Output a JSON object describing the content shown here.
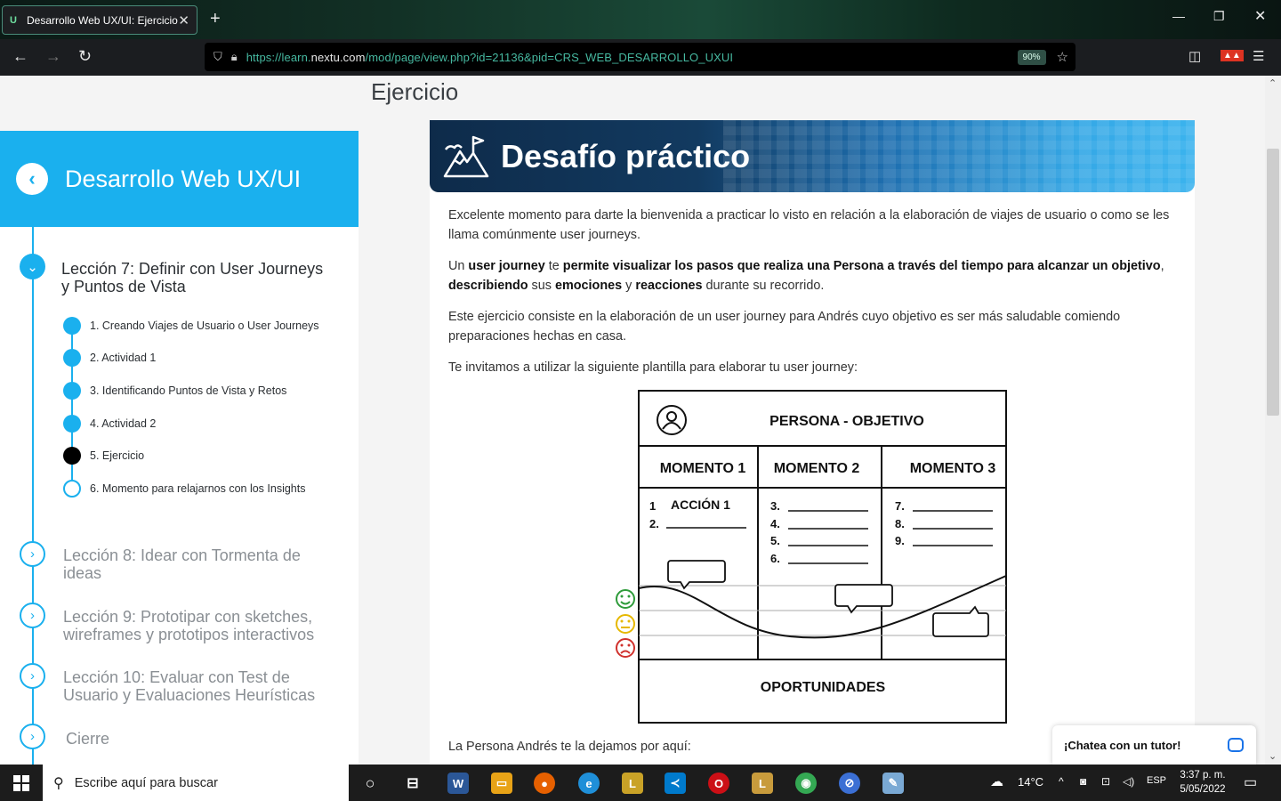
{
  "browser": {
    "tab_title": "Desarrollo Web UX/UI: Ejercicio",
    "tab_favicon": "U",
    "url_prefix": "https://learn.",
    "url_domain": "nextu.com",
    "url_path": "/mod/page/view.php?id=21136&pid=CRS_WEB_DESARROLLO_UXUI",
    "zoom": "90%"
  },
  "page": {
    "title": "Ejercicio"
  },
  "sidebar": {
    "course_title": "Desarrollo Web UX/UI",
    "active_lesson": "Lección 7: Definir con User Journeys y Puntos de Vista",
    "subitems": [
      {
        "label": "1. Creando Viajes de Usuario o User Journeys",
        "state": "done"
      },
      {
        "label": "2. Actividad 1",
        "state": "done"
      },
      {
        "label": "3. Identificando Puntos de Vista y Retos",
        "state": "done"
      },
      {
        "label": "4. Actividad 2",
        "state": "done"
      },
      {
        "label": "5. Ejercicio",
        "state": "current"
      },
      {
        "label": "6. Momento para relajarnos con los Insights",
        "state": "pending"
      }
    ],
    "lessons": [
      {
        "label": "Lección 8: Idear con Tormenta de ideas"
      },
      {
        "label": "Lección 9: Prototipar con sketches, wireframes y prototipos interactivos"
      },
      {
        "label": "Lección 10: Evaluar con Test de Usuario y Evaluaciones Heurísticas"
      },
      {
        "label": "Cierre"
      }
    ]
  },
  "content": {
    "banner_title": "Desafío práctico",
    "p1": "Excelente momento para darte la bienvenida a practicar lo visto en relación a la elaboración de viajes de usuario o como se les llama comúnmente user journeys.",
    "p2": {
      "t1": "Un ",
      "b1": "user journey",
      "t2": " te ",
      "b2": "permite visualizar los pasos que realiza una Persona a través del tiempo para alcanzar un objetivo",
      "t3": ", ",
      "b3": "describiendo",
      "t4": " sus ",
      "b4": "emociones",
      "t5": " y ",
      "b5": "reacciones",
      "t6": " durante su recorrido."
    },
    "p3": "Este ejercicio consiste en la elaboración de un user journey para Andrés cuyo objetivo es ser más saludable comiendo preparaciones hechas en casa.",
    "p4": "Te invitamos a utilizar la siguiente plantilla para elaborar tu user journey:",
    "p5": "La Persona Andrés te la dejamos por aquí:"
  },
  "diagram": {
    "header": "PERSONA - OBJETIVO",
    "moments": [
      "MOMENTO 1",
      "MOMENTO 2",
      "MOMENTO 3"
    ],
    "col1": [
      "1",
      "ACCIÓN 1",
      "2."
    ],
    "col2": [
      "3.",
      "4.",
      "5.",
      "6."
    ],
    "col3": [
      "7.",
      "8.",
      "9."
    ],
    "footer": "OPORTUNIDADES",
    "emotions": [
      "happy-face",
      "neutral-face",
      "sad-face"
    ],
    "emotion_colors": [
      "#2e9b3a",
      "#e6b800",
      "#d0312d"
    ]
  },
  "chat": {
    "label": "¡Chatea con un tutor!"
  },
  "taskbar": {
    "search_placeholder": "Escribe aquí para buscar",
    "temperature": "14°C",
    "language": "ESP",
    "time": "3:37 p. m.",
    "date": "5/05/2022"
  }
}
